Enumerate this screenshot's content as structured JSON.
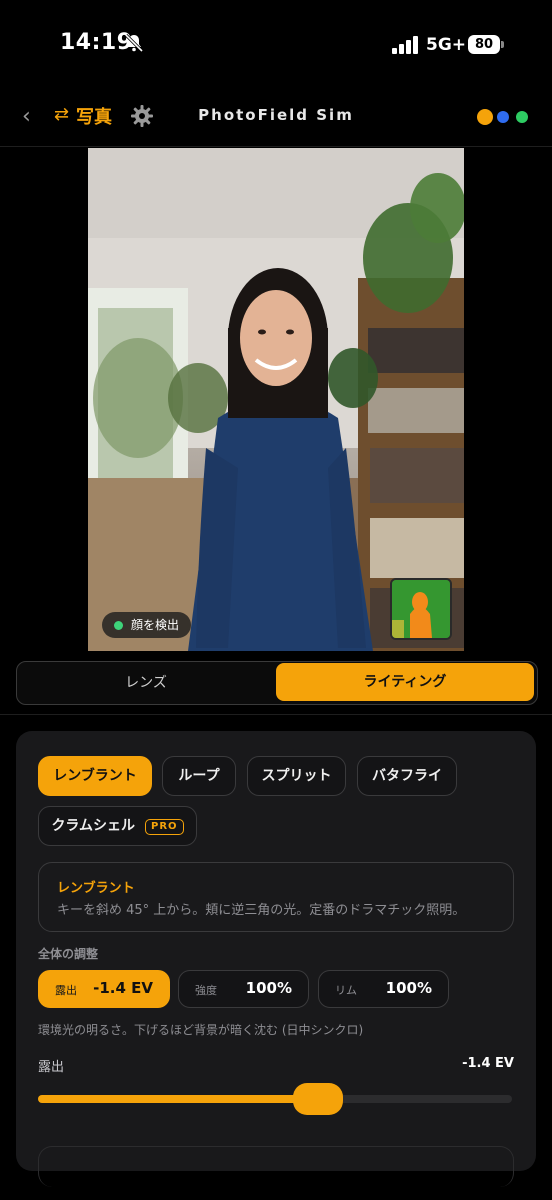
{
  "status_bar": {
    "time": "14:19",
    "network": "5G+",
    "battery": "80"
  },
  "nav": {
    "photo_label": "写真",
    "title": "PhotoField Sim",
    "dots": [
      "#f5a30a",
      "#2f6cf0",
      "#2ecc63"
    ]
  },
  "photo": {
    "face_badge": "顔を検出"
  },
  "segments": {
    "lens": "レンズ",
    "lighting": "ライティング",
    "selected": "lighting"
  },
  "presets": {
    "items": [
      "レンブラント",
      "ループ",
      "スプリット",
      "バタフライ",
      "クラムシェル"
    ],
    "pro_badge": "PRO",
    "selected": "レンブラント"
  },
  "description": {
    "title": "レンブラント",
    "text": "キーを斜め 45° 上から。頬に逆三角の光。定番のドラマチック照明。"
  },
  "adjust": {
    "section_label": "全体の調整",
    "exposure_label": "露出",
    "exposure_value": "-1.4 EV",
    "intensity_label": "強度",
    "intensity_value": "100%",
    "rim_label": "リム",
    "rim_value": "100%",
    "hint": "環境光の明るさ。下げるほど背景が暗く沈む (日中シンクロ)"
  },
  "slider": {
    "label": "露出",
    "value": "-1.4 EV",
    "fraction": 0.59
  }
}
